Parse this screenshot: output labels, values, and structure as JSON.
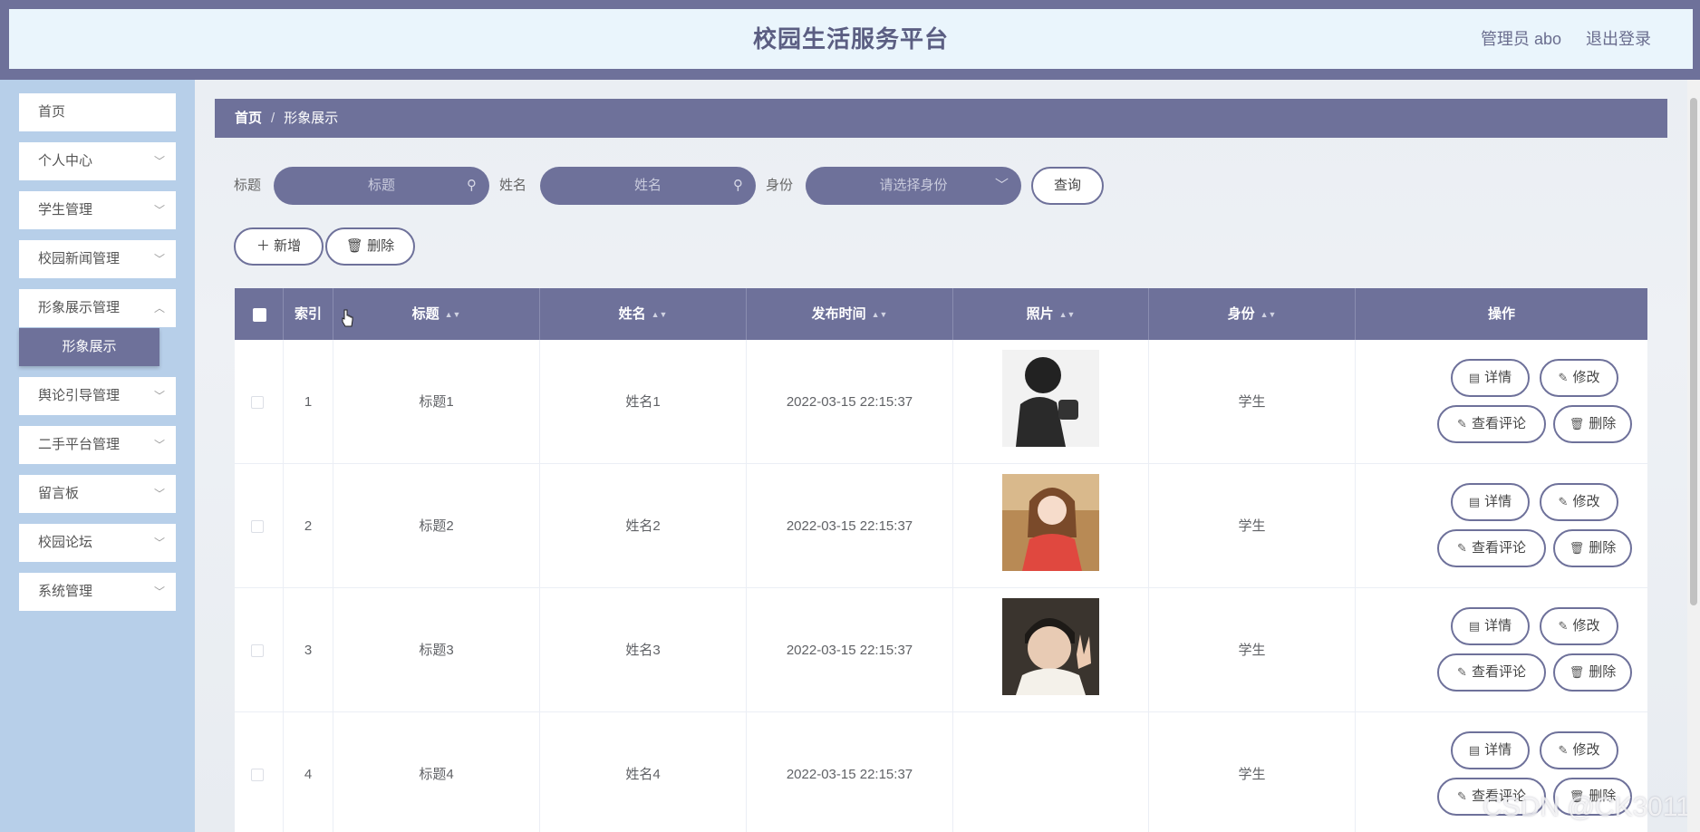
{
  "header": {
    "title": "校园生活服务平台",
    "user": "管理员 abo",
    "logout": "退出登录"
  },
  "sidebar": {
    "items": [
      {
        "label": "首页",
        "has_children": false
      },
      {
        "label": "个人中心",
        "has_children": true
      },
      {
        "label": "学生管理",
        "has_children": true
      },
      {
        "label": "校园新闻管理",
        "has_children": true
      },
      {
        "label": "形象展示管理",
        "has_children": true
      },
      {
        "label": "舆论引导管理",
        "has_children": true
      },
      {
        "label": "二手平台管理",
        "has_children": true
      },
      {
        "label": "留言板",
        "has_children": true
      },
      {
        "label": "校园论坛",
        "has_children": true
      },
      {
        "label": "系统管理",
        "has_children": true
      }
    ],
    "active_subitem": "形象展示"
  },
  "breadcrumb": {
    "home": "首页",
    "separator": "/",
    "current": "形象展示"
  },
  "filters": {
    "title_label": "标题",
    "title_placeholder": "标题",
    "name_label": "姓名",
    "name_placeholder": "姓名",
    "role_label": "身份",
    "role_placeholder": "请选择身份",
    "query_button": "查询"
  },
  "actions": {
    "add": "新增",
    "delete": "删除"
  },
  "table": {
    "columns": [
      "索引",
      "标题",
      "姓名",
      "发布时间",
      "照片",
      "身份",
      "操作"
    ],
    "rows": [
      {
        "index": "1",
        "title": "标题1",
        "name": "姓名1",
        "time": "2022-03-15 22:15:37",
        "photo": "photo-1",
        "role": "学生"
      },
      {
        "index": "2",
        "title": "标题2",
        "name": "姓名2",
        "time": "2022-03-15 22:15:37",
        "photo": "photo-2",
        "role": "学生"
      },
      {
        "index": "3",
        "title": "标题3",
        "name": "姓名3",
        "time": "2022-03-15 22:15:37",
        "photo": "photo-3",
        "role": "学生"
      },
      {
        "index": "4",
        "title": "标题4",
        "name": "姓名4",
        "time": "2022-03-15 22:15:37",
        "photo": "",
        "role": "学生"
      }
    ],
    "row_buttons": {
      "detail": "详情",
      "edit": "修改",
      "comments": "查看评论",
      "delete": "删除"
    }
  },
  "watermark": "CSDN @CK3011",
  "colors": {
    "primary": "#6e719a",
    "sidebar_bg": "#b7cfe9",
    "header_bg": "#eaf5fc"
  }
}
